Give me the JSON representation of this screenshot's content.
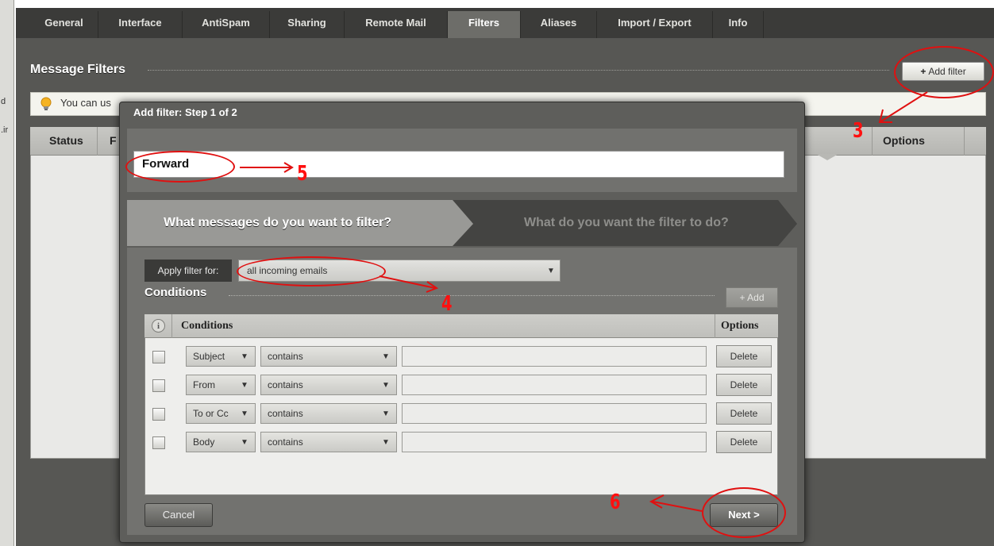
{
  "left_strip": {
    "fragments": [
      "d",
      ".ir"
    ]
  },
  "tabs": [
    {
      "label": "General"
    },
    {
      "label": "Interface"
    },
    {
      "label": "AntiSpam"
    },
    {
      "label": "Sharing"
    },
    {
      "label": "Remote Mail"
    },
    {
      "label": "Filters"
    },
    {
      "label": "Aliases"
    },
    {
      "label": "Import / Export"
    },
    {
      "label": "Info"
    }
  ],
  "active_tab": "Filters",
  "page": {
    "title": "Message Filters",
    "add_filter_label": "Add filter",
    "add_filter_plus": "+",
    "tip_text": "You can us",
    "columns": {
      "status": "Status",
      "f": "F",
      "options": "Options"
    }
  },
  "modal": {
    "title": "Add filter: Step 1 of 2",
    "filter_name": "Forward",
    "steps": {
      "step1": "What messages do you want to filter?",
      "step2": "What do you want the filter to do?"
    },
    "apply_label": "Apply filter for:",
    "apply_value": "all incoming emails",
    "conditions_title": "Conditions",
    "add_condition_label": "+ Add",
    "table": {
      "info_icon": "i",
      "conditions_header": "Conditions",
      "options_header": "Options",
      "rows": [
        {
          "field": "Subject",
          "operator": "contains",
          "value": "",
          "delete": "Delete"
        },
        {
          "field": "From",
          "operator": "contains",
          "value": "",
          "delete": "Delete"
        },
        {
          "field": "To or Cc",
          "operator": "contains",
          "value": "",
          "delete": "Delete"
        },
        {
          "field": "Body",
          "operator": "contains",
          "value": "",
          "delete": "Delete"
        }
      ]
    },
    "cancel_label": "Cancel",
    "next_label": "Next >"
  },
  "annotations": {
    "n3": "3",
    "n4": "4",
    "n5": "5",
    "n6": "6"
  },
  "colors": {
    "annotation": "#e01010",
    "panel": "#575754",
    "tabbar": "#3b3b39"
  }
}
